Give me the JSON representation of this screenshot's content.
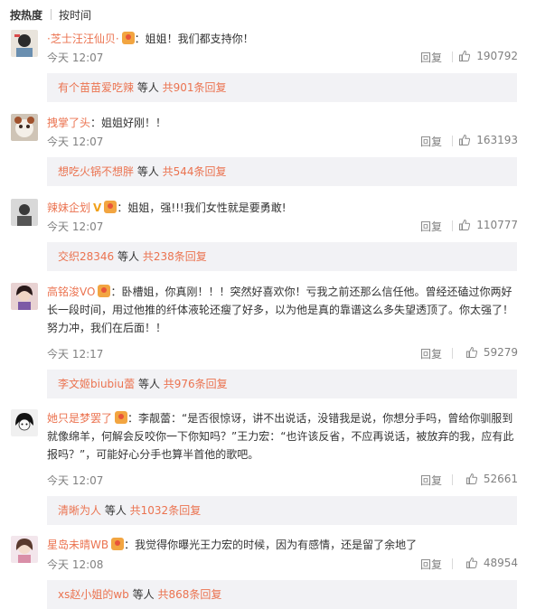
{
  "tabs": [
    {
      "label": "按热度",
      "active": true
    },
    {
      "label": "按时间",
      "active": false
    }
  ],
  "reply_label": "回复",
  "colors": {
    "accent": "#eb7350",
    "meta": "#808080",
    "sub_bg": "#f2f2f5"
  },
  "comments": [
    {
      "user": "·芝士汪汪仙贝·",
      "badge": "vip-badge-icon",
      "text": "：姐姐！我们都支持你！",
      "time": "今天 12:07",
      "likes": "190792",
      "sub": {
        "user": "有个苗苗爱吃辣",
        "middle": " 等人 ",
        "count": "共901条回复"
      }
    },
    {
      "user": "拽掌了头",
      "text": "：姐姐好刚！！",
      "time": "今天 12:07",
      "likes": "163193",
      "sub": {
        "user": "想吃火锅不想胖",
        "middle": " 等人 ",
        "count": "共544条回复"
      }
    },
    {
      "user": "辣妹企划",
      "verified": "V",
      "badge": "vip-badge-icon",
      "text": "：姐姐，强!!!我们女性就是要勇敢!",
      "time": "今天 12:07",
      "likes": "110777",
      "sub": {
        "user": "交织28346",
        "middle": " 等人 ",
        "count": "共238条回复"
      }
    },
    {
      "user": "高铭浚VO",
      "badge": "vip-badge-icon",
      "text_lines": [
        "：卧槽姐，你真刚！！！突然好喜欢你！亏我之前还那么信任他。曾经还磕过你两好",
        "长一段时间，用过他推的纤体液轮还瘦了好多，以为他是真的靠谱这么多失望透顶了。你太强了！",
        "努力冲，我们在后面！！"
      ],
      "time": "今天 12:17",
      "likes": "59279",
      "sub": {
        "user": "李文姬biubiu蕾",
        "middle": " 等人 ",
        "count": "共976条回复"
      }
    },
    {
      "user": "她只是梦罢了",
      "badge": "vip-badge-icon",
      "text_lines": [
        "：李靓蕾：“是否很惊讶，讲不出说话，没错我是说，你想分手吗，曾给你驯服到",
        "就像绵羊，何解会反咬你一下你知吗？”王力宏：“也许该反省，不应再说话，被放弃的我，应有此",
        "报吗？”，可能好心分手也算半首他的歌吧。"
      ],
      "time": "今天 12:07",
      "likes": "52661",
      "sub": {
        "user": "清晰为人",
        "middle": " 等人 ",
        "count": "共1032条回复"
      }
    },
    {
      "user": "星岛未晴WB",
      "badge": "vip-badge-icon",
      "text": "：我觉得你曝光王力宏的时候，因为有感情，还是留了余地了",
      "time": "今天 12:08",
      "likes": "48954",
      "sub": {
        "user": "xs赵小姐的wb",
        "middle": " 等人 ",
        "count": "共868条回复"
      }
    }
  ]
}
